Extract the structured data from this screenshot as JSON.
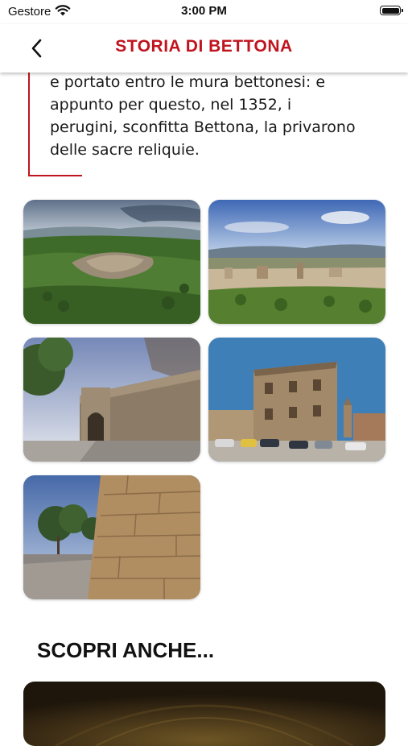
{
  "status_bar": {
    "carrier": "Gestore",
    "time": "3:00 PM"
  },
  "nav": {
    "title": "STORIA DI BETTONA",
    "back_icon": "chevron-left-icon"
  },
  "quote": {
    "lines": [
      "e portato entro le mura bettonesi: e",
      "appunto per questo, nel 1352, i",
      "perugini, sconfitta Bettona, la privarono",
      "delle sacre reliquie."
    ],
    "accent_color": "#c0141e"
  },
  "gallery": {
    "photos": [
      {
        "subject": "aerial view of hill town"
      },
      {
        "subject": "town panorama with valley"
      },
      {
        "subject": "stone gate and wall"
      },
      {
        "subject": "town hall piazza"
      },
      {
        "subject": "stone wall and trees"
      }
    ]
  },
  "discover": {
    "title": "SCOPRI ANCHE..."
  }
}
